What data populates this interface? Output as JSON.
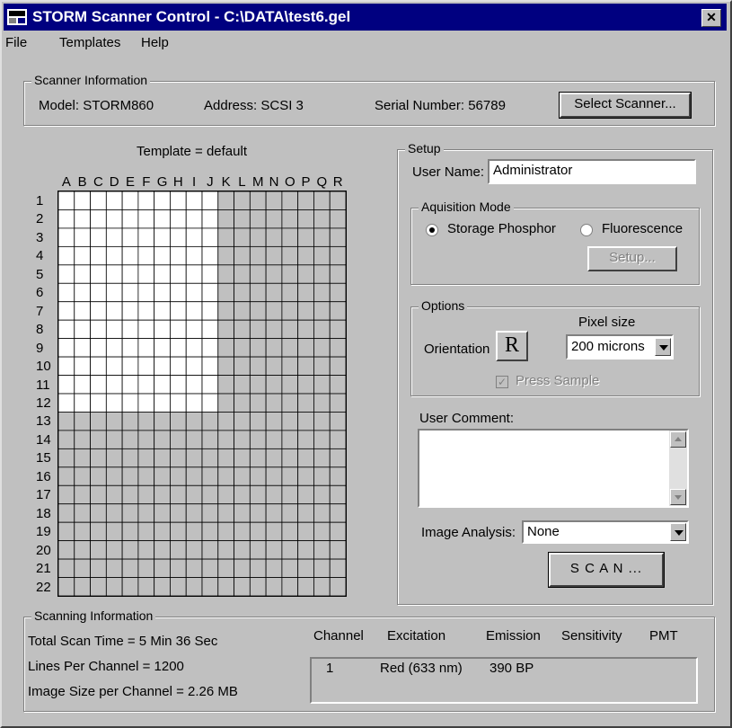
{
  "window": {
    "title": "STORM Scanner Control - C:\\DATA\\test6.gel",
    "close": "✕",
    "app_icon": "storm-app-icon"
  },
  "menu": [
    "File",
    "Templates",
    "Help"
  ],
  "scanner_info": {
    "legend": "Scanner Information",
    "model": "Model:  STORM860",
    "address": "Address:  SCSI 3",
    "serial": "Serial Number:  56789",
    "select_button": "Select Scanner..."
  },
  "template": {
    "title": "Template = default",
    "columns": [
      "A",
      "B",
      "C",
      "D",
      "E",
      "F",
      "G",
      "H",
      "I",
      "J",
      "K",
      "L",
      "M",
      "N",
      "O",
      "P",
      "Q",
      "R"
    ],
    "rows": [
      "1",
      "2",
      "3",
      "4",
      "5",
      "6",
      "7",
      "8",
      "9",
      "10",
      "11",
      "12",
      "13",
      "14",
      "15",
      "16",
      "17",
      "18",
      "19",
      "20",
      "21",
      "22"
    ],
    "selected_columns": 10,
    "selected_rows": 12,
    "selected_color": "#ffffff",
    "unselected_color": "#c0c0c0"
  },
  "setup": {
    "legend": "Setup",
    "user_name_label": "User Name:",
    "user_name_value": "Administrator",
    "acq_legend": "Aquisition Mode",
    "mode_storage": "Storage Phosphor",
    "mode_fluorescence": "Fluorescence",
    "mode_selected": "Storage Phosphor",
    "setup_button": "Setup...",
    "options_legend": "Options",
    "orientation_label": "Orientation",
    "orientation_glyph": "R",
    "pixel_size_label": "Pixel size",
    "pixel_size_value": "200 microns",
    "press_sample_label": "Press Sample",
    "press_sample_checked": true,
    "comment_label": "User Comment:",
    "comment_value": "",
    "image_analysis_label": "Image Analysis:",
    "image_analysis_value": "None",
    "scan_button": "S C A N ..."
  },
  "scanning_info": {
    "legend": "Scanning Information",
    "total_time": "Total Scan Time =  5 Min 36 Sec",
    "lines": "Lines Per Channel =  1200",
    "image_size": "Image Size per Channel =  2.26 MB",
    "headers": [
      "Channel",
      "Excitation",
      "Emission",
      "Sensitivity",
      "PMT"
    ],
    "rows": [
      {
        "channel": "1",
        "excitation": "Red (633 nm)",
        "emission": "390 BP",
        "sensitivity": "",
        "pmt": ""
      }
    ]
  }
}
